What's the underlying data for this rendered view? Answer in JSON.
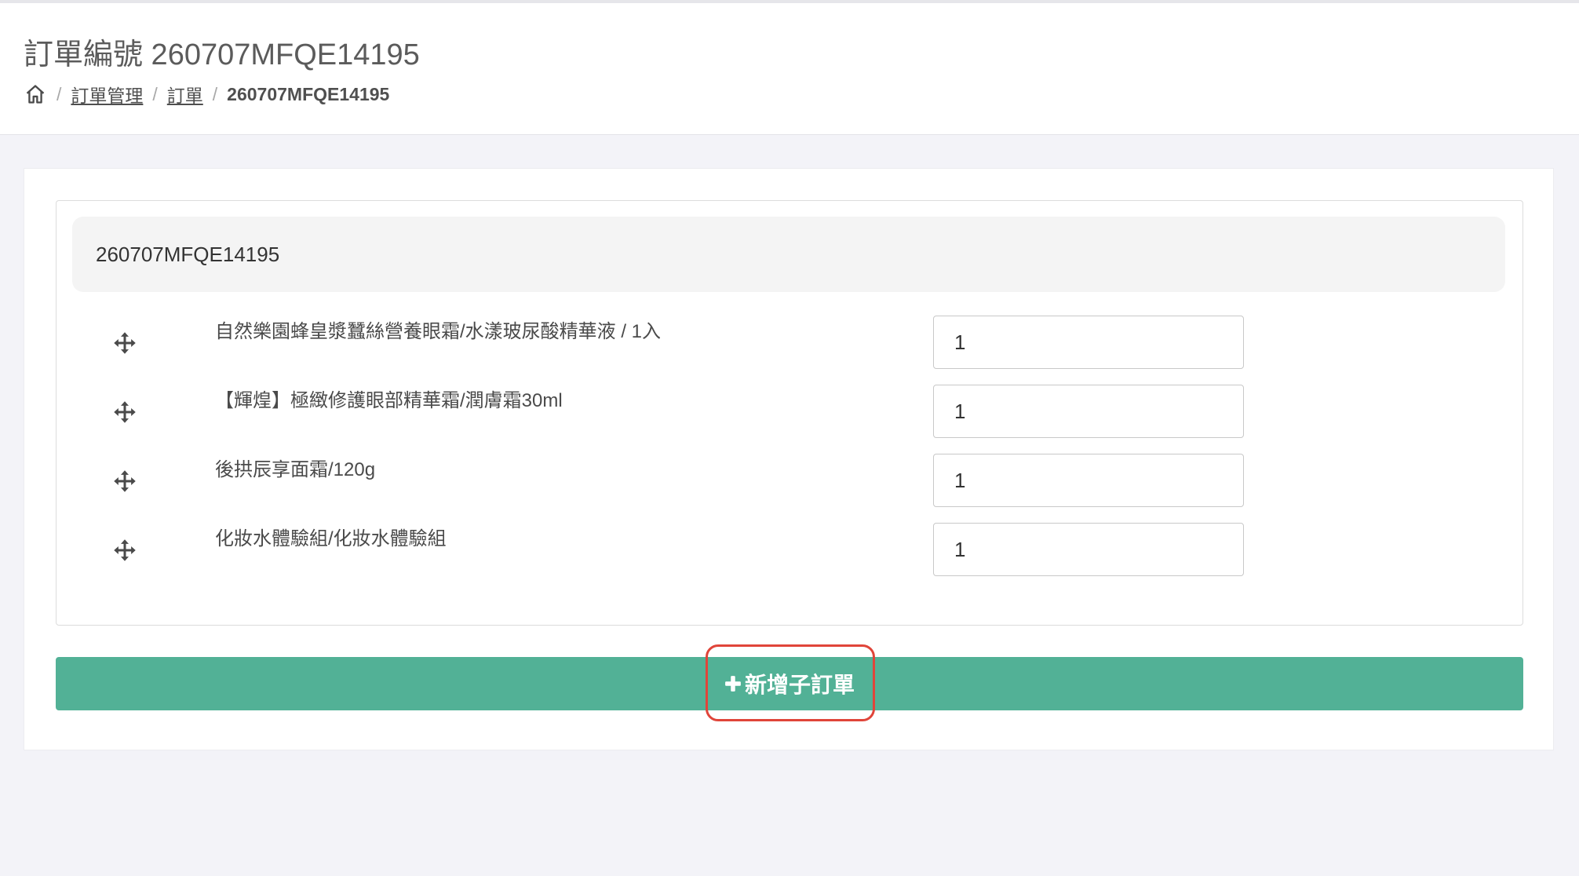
{
  "header": {
    "title": "訂單編號 260707MFQE14195",
    "breadcrumb": {
      "home_icon": "home-icon",
      "separator": "/",
      "items": [
        "訂單管理",
        "訂單"
      ],
      "current": "260707MFQE14195"
    }
  },
  "order": {
    "id": "260707MFQE14195",
    "items": [
      {
        "name": "自然樂園蜂皇漿蠶絲營養眼霜/水漾玻尿酸精華液 / 1入",
        "quantity": "1",
        "icon": "move-icon"
      },
      {
        "name": "【輝煌】極緻修護眼部精華霜/潤膚霜30ml",
        "quantity": "1",
        "icon": "move-icon"
      },
      {
        "name": "後拱辰享面霜/120g",
        "quantity": "1",
        "icon": "move-icon"
      },
      {
        "name": "化妝水體驗組/化妝水體驗組",
        "quantity": "1",
        "icon": "move-icon"
      }
    ]
  },
  "actions": {
    "add_suborder_label": "新增子訂單",
    "add_icon": "plus-icon"
  },
  "colors": {
    "accent_green": "#52b196",
    "highlight_red": "#e0453a",
    "page_bg": "#f3f3f8"
  }
}
